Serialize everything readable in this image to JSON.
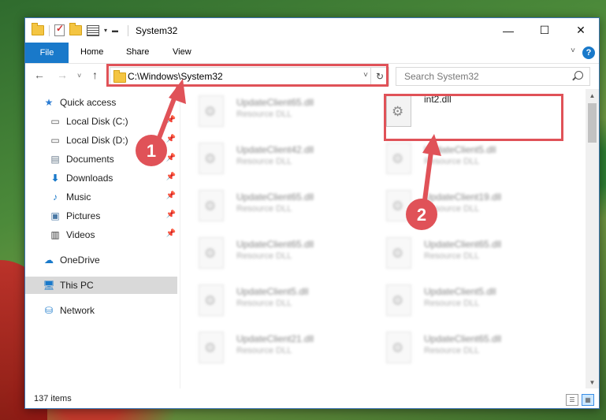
{
  "window": {
    "title": "System32"
  },
  "colors": {
    "accent": "#1979ca",
    "annotation": "#e05258",
    "selection": "#cce8ff"
  },
  "quick_access_toolbar": {
    "icons": [
      "folder-icon",
      "properties-check-icon",
      "new-folder-icon",
      "properties-icon",
      "dropdown-icon"
    ]
  },
  "ribbon": {
    "tabs": [
      "File",
      "Home",
      "Share",
      "View"
    ],
    "help": "?"
  },
  "nav": {
    "address": "C:\\Windows\\System32",
    "search_placeholder": "Search System32"
  },
  "sidebar": {
    "items": [
      {
        "label": "Quick access",
        "icon": "star-icon"
      },
      {
        "label": "Local Disk (C:)",
        "icon": "drive-icon",
        "pinned": true
      },
      {
        "label": "Local Disk (D:)",
        "icon": "drive-icon",
        "pinned": true
      },
      {
        "label": "Documents",
        "icon": "documents-icon",
        "pinned": true
      },
      {
        "label": "Downloads",
        "icon": "download-icon",
        "pinned": true
      },
      {
        "label": "Music",
        "icon": "music-icon",
        "pinned": true
      },
      {
        "label": "Pictures",
        "icon": "pictures-icon",
        "pinned": true
      },
      {
        "label": "Videos",
        "icon": "videos-icon",
        "pinned": true
      },
      {
        "label": "OneDrive",
        "icon": "cloud-icon"
      },
      {
        "label": "This PC",
        "icon": "computer-icon",
        "selected": true
      },
      {
        "label": "Network",
        "icon": "network-icon"
      }
    ]
  },
  "files": {
    "left": [
      {
        "name": "UpdateClient65.dll",
        "type": "Resource DLL"
      },
      {
        "name": "UpdateClient42.dll",
        "type": "Resource DLL"
      },
      {
        "name": "UpdateClient65.dll",
        "type": "Resource DLL"
      },
      {
        "name": "UpdateClient65.dll",
        "type": "Resource DLL"
      },
      {
        "name": "UpdateClient5.dll",
        "type": "Resource DLL"
      },
      {
        "name": "UpdateClient21.dll",
        "type": "Resource DLL"
      }
    ],
    "right": [
      {
        "name": "int2.dll",
        "type": ""
      },
      {
        "name": "UpdateClient5.dll",
        "type": "Resource DLL"
      },
      {
        "name": "UpdateClient19.dll",
        "type": "Resource DLL"
      },
      {
        "name": "UpdateClient65.dll",
        "type": "Resource DLL"
      },
      {
        "name": "UpdateClient5.dll",
        "type": "Resource DLL"
      },
      {
        "name": "UpdateClient65.dll",
        "type": "Resource DLL"
      }
    ]
  },
  "status": {
    "count": "137 items"
  },
  "annotations": {
    "step1": "1",
    "step2": "2"
  }
}
